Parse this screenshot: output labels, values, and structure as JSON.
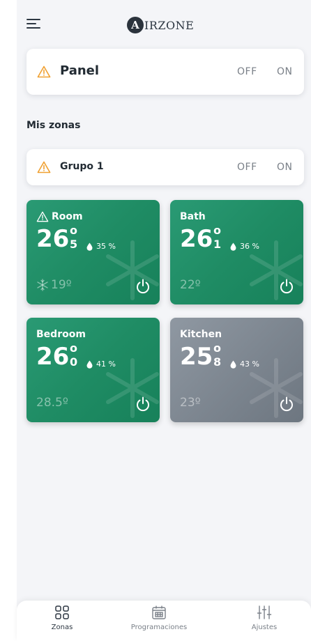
{
  "app": {
    "logo_letter": "A",
    "logo_rest": "IRZONE"
  },
  "panel": {
    "title": "Panel",
    "off_label": "OFF",
    "on_label": "ON",
    "warning_icon": "warning-triangle-icon"
  },
  "section": {
    "title": "Mis zonas"
  },
  "group": {
    "title": "Grupo 1",
    "off_label": "OFF",
    "on_label": "ON"
  },
  "zones": [
    {
      "name": "Room",
      "temp_int": "26",
      "temp_deg": "o",
      "temp_dec": "5",
      "humidity": "35 %",
      "setpoint": "19º",
      "mode_icon": "snowflake-icon",
      "warning": true,
      "state": "active"
    },
    {
      "name": "Bath",
      "temp_int": "26",
      "temp_deg": "o",
      "temp_dec": "1",
      "humidity": "36 %",
      "setpoint": "22º",
      "warning": false,
      "state": "active"
    },
    {
      "name": "Bedroom",
      "temp_int": "26",
      "temp_deg": "o",
      "temp_dec": "0",
      "humidity": "41 %",
      "setpoint": "28.5º",
      "warning": false,
      "state": "active"
    },
    {
      "name": "Kitchen",
      "temp_int": "25",
      "temp_deg": "o",
      "temp_dec": "8",
      "humidity": "43 %",
      "setpoint": "23º",
      "warning": false,
      "state": "off"
    }
  ],
  "nav": [
    {
      "label": "Zonas",
      "icon": "grid-icon",
      "active": true
    },
    {
      "label": "Programaciones",
      "icon": "calendar-icon",
      "active": false
    },
    {
      "label": "Ajustes",
      "icon": "sliders-icon",
      "active": false
    }
  ],
  "colors": {
    "zone_active": "#1f8c64",
    "zone_off": "#7c858f",
    "warning": "#f0a030",
    "text_dark": "#222b33",
    "toggle_text": "#7a8088"
  }
}
